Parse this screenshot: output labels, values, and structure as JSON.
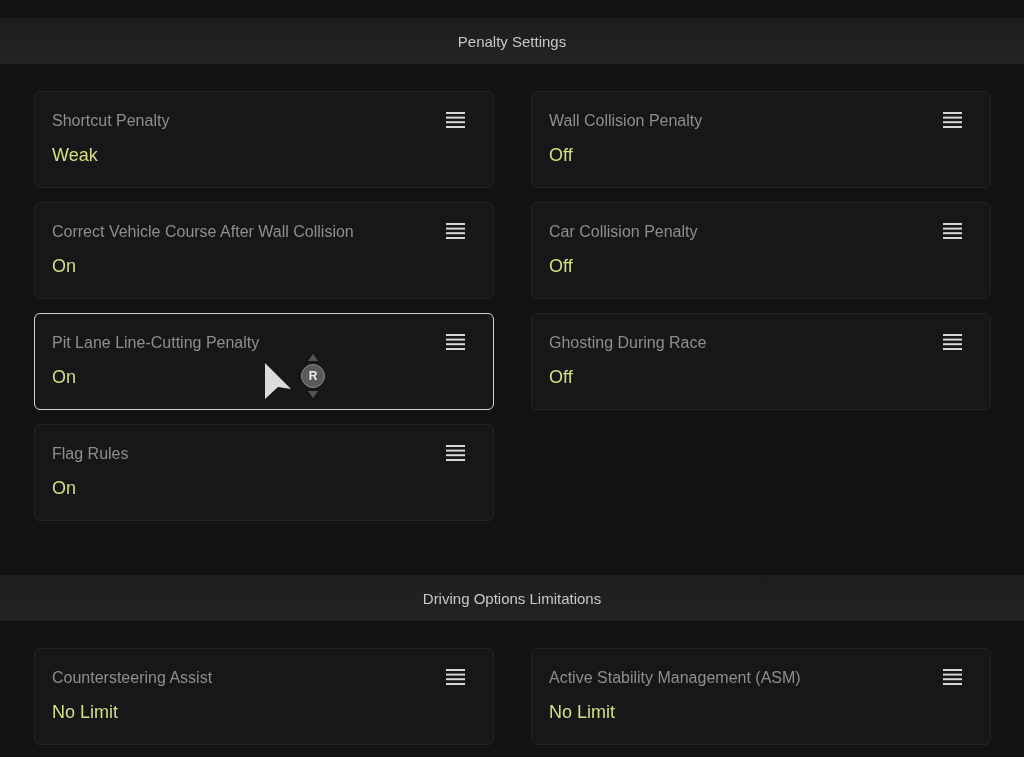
{
  "sections": [
    {
      "title": "Penalty Settings",
      "settings": [
        {
          "label": "Shortcut Penalty",
          "value": "Weak",
          "selected": false
        },
        {
          "label": "Wall Collision Penalty",
          "value": "Off",
          "selected": false
        },
        {
          "label": "Correct Vehicle Course After Wall Collision",
          "value": "On",
          "selected": false
        },
        {
          "label": "Car Collision Penalty",
          "value": "Off",
          "selected": false
        },
        {
          "label": "Pit Lane Line-Cutting Penalty",
          "value": "On",
          "selected": true
        },
        {
          "label": "Ghosting During Race",
          "value": "Off",
          "selected": false
        },
        {
          "label": "Flag Rules",
          "value": "On",
          "selected": false
        }
      ]
    },
    {
      "title": "Driving Options Limitations",
      "settings": [
        {
          "label": "Countersteering Assist",
          "value": "No Limit",
          "selected": false
        },
        {
          "label": "Active Stability Management (ASM)",
          "value": "No Limit",
          "selected": false
        }
      ]
    }
  ],
  "cursor": {
    "badge": "R"
  }
}
